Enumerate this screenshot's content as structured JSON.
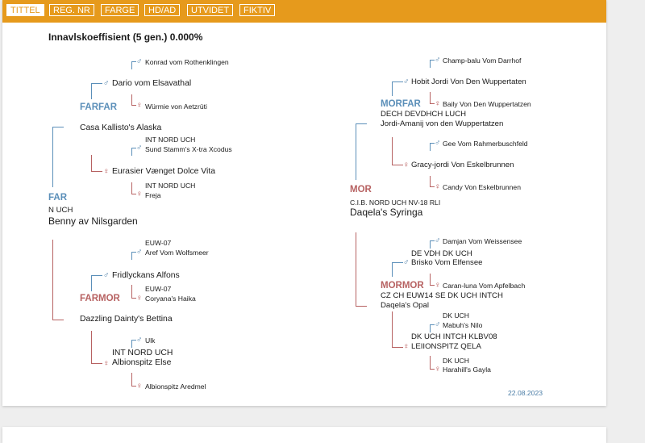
{
  "tabs": [
    "TITTEL",
    "REG. NR",
    "FARGE",
    "HD/AD",
    "UTVIDET",
    "FIKTIV"
  ],
  "inbreeding": "Innavlskoeffisient (5 gen.) 0.000%",
  "date": "22.08.2023",
  "symbols": {
    "male": "♂",
    "female": "♀"
  },
  "colors": {
    "accent": "#e69a1c",
    "male": "#5b8fb9",
    "female": "#b76262"
  },
  "pedigree": {
    "far": {
      "role": "FAR",
      "title": "N UCH",
      "name": "Benny av Nilsgarden"
    },
    "farfar": {
      "role": "FARFAR",
      "name": "Casa Kallisto's Alaska"
    },
    "farfar_far": {
      "name": "Dario vom Elsavathal"
    },
    "farfar_far_far": {
      "name": "Konrad vom Rothenklingen"
    },
    "farfar_far_mor": {
      "name": "Würmie von Aetzrüti"
    },
    "farfar_mor": {
      "name": "Eurasier Vænget Dolce Vita"
    },
    "farfar_mor_far": {
      "title": "INT NORD UCH",
      "name": "Sund Stamm's X-tra Xcodus"
    },
    "farfar_mor_mor": {
      "title": "INT NORD UCH",
      "name": "Freja"
    },
    "farmor": {
      "role": "FARMOR",
      "name": "Dazzling Dainty's Bettina"
    },
    "farmor_far": {
      "name": "Fridlyckans Alfons"
    },
    "farmor_far_far": {
      "title": "EUW-07",
      "name": "Aref Vom Wolfsmeer"
    },
    "farmor_far_mor": {
      "title": "EUW-07",
      "name": "Coryana's Haika"
    },
    "farmor_mor": {
      "title": "INT NORD UCH",
      "name": "Albionspitz Else"
    },
    "farmor_mor_far": {
      "name": "Ulk"
    },
    "farmor_mor_mor": {
      "name": "Albionspitz Aredmel"
    },
    "mor": {
      "role": "MOR",
      "title": "C.I.B. NORD UCH NV-18 RLI",
      "name": "Daqela's Syringa"
    },
    "morfar": {
      "role": "MORFAR",
      "title": "DECH DEVDHCH LUCH",
      "name": "Jordi-Amanij von den Wuppertatzen"
    },
    "morfar_far": {
      "name": "Hobit Jordi Von Den Wuppertaten"
    },
    "morfar_far_far": {
      "name": "Champ-balu Vom Darrhof"
    },
    "morfar_far_mor": {
      "name": "Baily Von Den Wuppertatzen"
    },
    "morfar_mor": {
      "name": "Gracy-jordi Von Eskelbrunnen"
    },
    "morfar_mor_far": {
      "name": "Gee Vom Rahmerbuschfeld"
    },
    "morfar_mor_mor": {
      "name": "Candy Von Eskelbrunnen"
    },
    "mormor": {
      "role": "MORMOR",
      "title": "CZ CH EUW14 SE DK UCH INTCH",
      "name": "Daqela's Opal"
    },
    "mormor_far": {
      "title": "DE VDH DK UCH",
      "name": "Brisko Vom Elfensee"
    },
    "mormor_far_far": {
      "name": "Damjan Vom Weissensee"
    },
    "mormor_far_mor": {
      "name": "Caran-luna Vom Apfelbach"
    },
    "mormor_mor": {
      "title": "DK UCH INTCH KLBV08",
      "name": "LEIIONSPITZ QELA"
    },
    "mormor_mor_far": {
      "title": "DK UCH",
      "name": "Mabuh's Nilo"
    },
    "mormor_mor_mor": {
      "title": "DK UCH",
      "name": "Harahill's Gayla"
    }
  }
}
